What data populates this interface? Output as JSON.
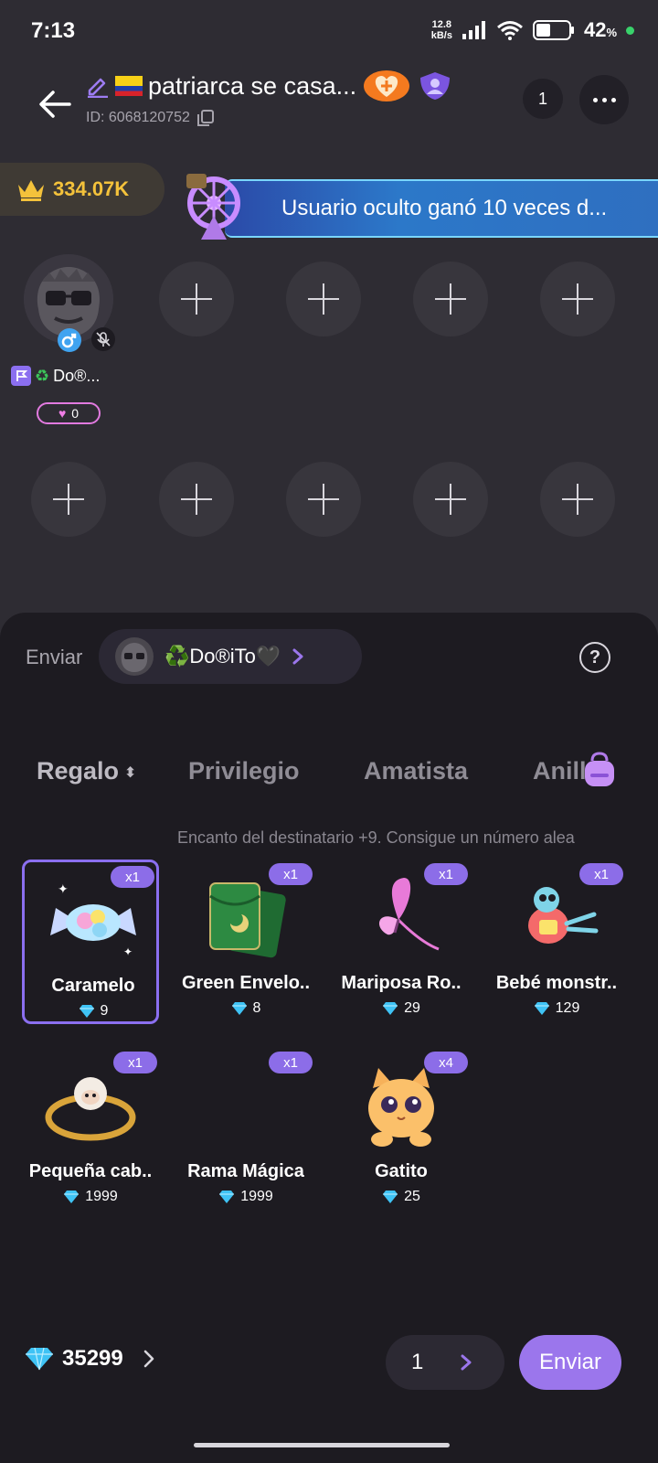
{
  "status_bar": {
    "time": "7:13",
    "net_speed_value": "12.8",
    "net_speed_unit": "kB/s",
    "battery": "42",
    "battery_unit": "%"
  },
  "header": {
    "room_title": "patriarca se casa...",
    "room_id": "ID: 6068120752",
    "viewer_count": "1"
  },
  "room": {
    "crown_value": "334.07K",
    "banner_text": "Usuario oculto ganó 10 veces d...",
    "host_name": "Do®...",
    "host_charm": "0"
  },
  "panel": {
    "send_label": "Enviar",
    "recipient_name": "♻️Do®iTo🖤",
    "help": "?",
    "tabs": [
      {
        "label": "Regalo"
      },
      {
        "label": "Privilegio"
      },
      {
        "label": "Amatista"
      },
      {
        "label": "Anill"
      }
    ],
    "hint": "Encanto del destinatario +9. Consigue un número alea",
    "gifts": [
      {
        "name": "Caramelo",
        "price": "9",
        "badge": "x1"
      },
      {
        "name": "Green Envelo..",
        "price": "8",
        "badge": "x1"
      },
      {
        "name": "Mariposa Ro..",
        "price": "29",
        "badge": "x1"
      },
      {
        "name": "Bebé monstr..",
        "price": "129",
        "badge": "x1"
      },
      {
        "name": "Pequeña cab..",
        "price": "1999",
        "badge": "x1"
      },
      {
        "name": "Rama Mágica",
        "price": "1999",
        "badge": "x1"
      },
      {
        "name": "Gatito",
        "price": "25",
        "badge": "x4"
      }
    ]
  },
  "footer": {
    "balance": "35299",
    "quantity": "1",
    "send_button": "Enviar"
  },
  "colors": {
    "accent": "#9b76ec",
    "badge": "#8c6de8",
    "crown": "#f4c23b",
    "diamond": "#3fc3f5"
  }
}
